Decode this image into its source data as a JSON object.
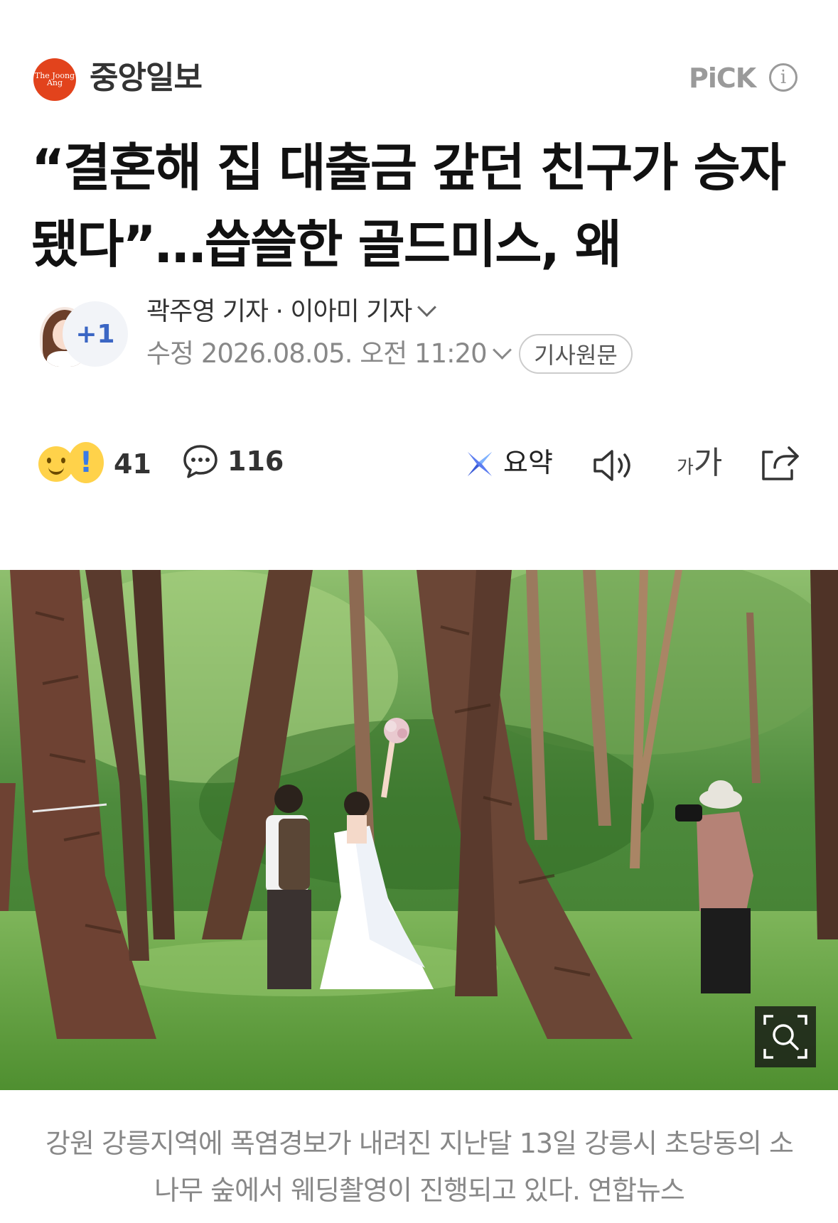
{
  "press": {
    "logo_text": "The Joong Ang",
    "name": "중앙일보",
    "pick_label": "PiCK",
    "info_glyph": "i"
  },
  "article": {
    "headline": "“결혼해 집 대출금 갚던 친구가 승자됐다”…씁쓸한 골드미스, 왜",
    "reporters": "곽주영 기자 · 이아미 기자",
    "extra_reporters": "+1",
    "modified": "수정 2026.08.05. 오전 11:20",
    "original_button": "기사원문",
    "caption": "강원 강릉지역에 폭염경보가 내려진 지난달 13일 강릉시 초당동의 소나무 숲에서 웨딩촬영이 진행되고 있다. 연합뉴스"
  },
  "actions": {
    "reaction_count": "41",
    "reaction_glyph": "!",
    "comment_count": "116",
    "summary_label": "요약",
    "font_small": "가",
    "font_large": "가"
  },
  "icons": [
    "reaction-icon",
    "comment-icon",
    "summary-icon",
    "tts-speaker-icon",
    "font-size-icon",
    "share-icon",
    "zoom-icon",
    "info-icon",
    "chevron-down-icon"
  ],
  "colors": {
    "press_red": "#e2431c",
    "accent_blue": "#3b66c4",
    "text_gray": "#888888"
  }
}
